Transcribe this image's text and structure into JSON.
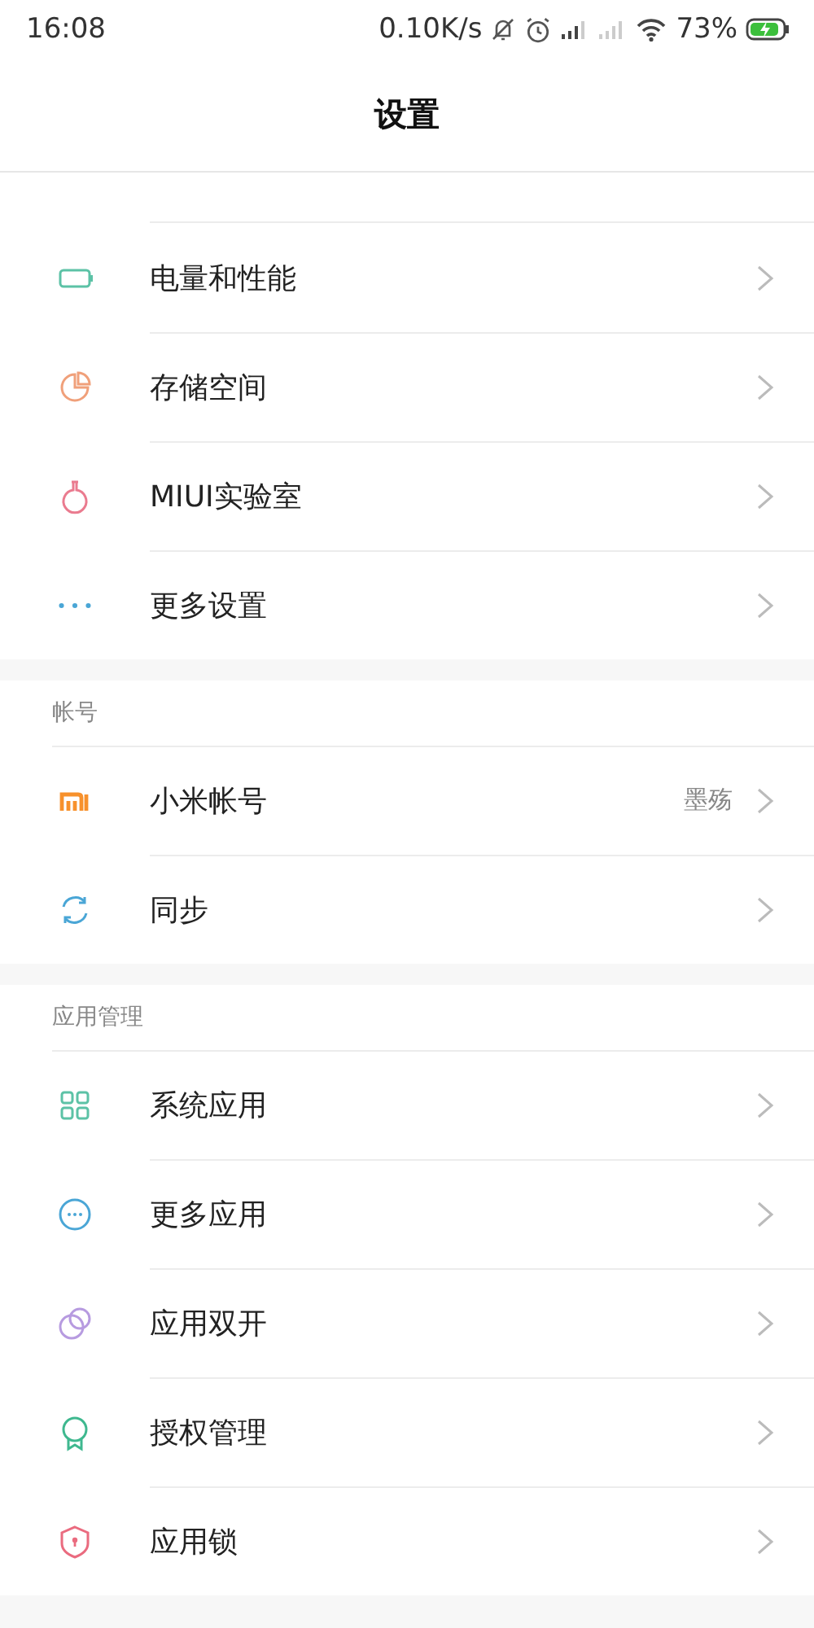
{
  "status_bar": {
    "time": "16:08",
    "speed": "0.10K/s",
    "battery": "73%"
  },
  "title": "设置",
  "sections": [
    {
      "items": [
        {
          "label": "电量和性能"
        },
        {
          "label": "存储空间"
        },
        {
          "label": "MIUI实验室"
        },
        {
          "label": "更多设置"
        }
      ]
    },
    {
      "header": "帐号",
      "items": [
        {
          "label": "小米帐号",
          "value": "墨殇"
        },
        {
          "label": "同步"
        }
      ]
    },
    {
      "header": "应用管理",
      "items": [
        {
          "label": "系统应用"
        },
        {
          "label": "更多应用"
        },
        {
          "label": "应用双开"
        },
        {
          "label": "授权管理"
        },
        {
          "label": "应用锁"
        }
      ]
    }
  ]
}
